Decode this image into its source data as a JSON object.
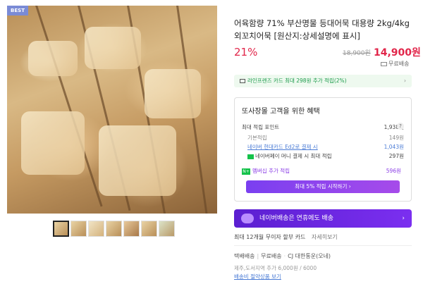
{
  "badge": "BEST",
  "product": {
    "title": "어육함량 71% 부산명물 등대어묵 대용량 2kg/4kg 외꼬치어묵 [원산지:상세설명에 표시]",
    "discount": "21%",
    "original_price": "18,900원",
    "sale_price": "14,900원",
    "shipping_label": "무료배송"
  },
  "card_banner": {
    "text": "라인프렌즈 카드 최대 298원 추가 적립(2%)",
    "arrow": "›"
  },
  "benefits": {
    "title": "또사장몰 고객을 위한 혜택",
    "max_points_label": "최대 적립 포인트",
    "max_points_value": "1,938원",
    "help_icon": "?",
    "rows": [
      {
        "label": "기본적립",
        "value": "149원"
      },
      {
        "label": "네이버 현대카드 Ed2로 결제 시",
        "value": "1,043원"
      },
      {
        "label": "네이버페이 머니 결제 시 최대 적립",
        "value": "297원"
      }
    ],
    "membership_label": "멤버십 추가 적립",
    "membership_value": "596원",
    "membership_icon_text": "N+",
    "membership_button": "최대 5% 적립 시작하기 ›"
  },
  "naver_delivery": {
    "text": "네이버배송은 연휴에도 배송",
    "arrow": "›"
  },
  "installment": {
    "text": "최대 12개월 무이자 할부 카드",
    "more": "자세히보기"
  },
  "delivery": {
    "type": "택배배송",
    "fee": "무료배송",
    "carrier": "CJ 대한통운(오네)",
    "extra": "제주,도서지역 추가 6,000원 / 6000",
    "bundle_link": "배송비 절약상품 보기"
  },
  "thumbnails": [
    "thumb-1",
    "thumb-2",
    "thumb-3",
    "thumb-4",
    "thumb-5",
    "thumb-6",
    "thumb-7"
  ],
  "colors": {
    "accent_red": "#e1264a",
    "naver_green": "#14c24a",
    "purple": "#7a3ff0"
  }
}
